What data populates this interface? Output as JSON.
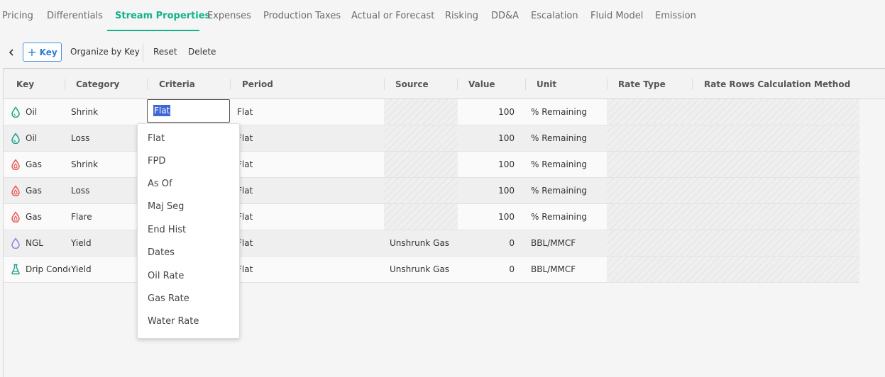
{
  "tabs": [
    {
      "label": "Pricing"
    },
    {
      "label": "Differentials"
    },
    {
      "label": "Stream Properties",
      "active": true
    },
    {
      "label": "Expenses"
    },
    {
      "label": "Production Taxes"
    },
    {
      "label": "Actual or Forecast"
    },
    {
      "label": "Risking"
    },
    {
      "label": "DD&A"
    },
    {
      "label": "Escalation"
    },
    {
      "label": "Fluid Model"
    },
    {
      "label": "Emission"
    }
  ],
  "toolbar": {
    "key_button": "Key",
    "organize": "Organize by Key",
    "reset": "Reset",
    "delete": "Delete"
  },
  "columns": [
    "Key",
    "Category",
    "Criteria",
    "Period",
    "Source",
    "Value",
    "Unit",
    "Rate Type",
    "Rate Rows Calculation Method"
  ],
  "rows": [
    {
      "key": "Oil",
      "icon": "oil-drop-icon",
      "category": "Shrink",
      "criteria": "Flat",
      "period": "Flat",
      "source": "",
      "value": "100",
      "unit": "% Remaining"
    },
    {
      "key": "Oil",
      "icon": "oil-drop-icon",
      "category": "Loss",
      "criteria": "",
      "period": "Flat",
      "source": "",
      "value": "100",
      "unit": "% Remaining"
    },
    {
      "key": "Gas",
      "icon": "gas-flame-icon",
      "category": "Shrink",
      "criteria": "",
      "period": "Flat",
      "source": "",
      "value": "100",
      "unit": "% Remaining"
    },
    {
      "key": "Gas",
      "icon": "gas-flame-icon",
      "category": "Loss",
      "criteria": "",
      "period": "Flat",
      "source": "",
      "value": "100",
      "unit": "% Remaining"
    },
    {
      "key": "Gas",
      "icon": "gas-flame-icon",
      "category": "Flare",
      "criteria": "",
      "period": "Flat",
      "source": "",
      "value": "100",
      "unit": "% Remaining"
    },
    {
      "key": "NGL",
      "icon": "ngl-drop-icon",
      "category": "Yield",
      "criteria": "",
      "period": "Flat",
      "source": "Unshrunk Gas",
      "value": "0",
      "unit": "BBL/MMCF"
    },
    {
      "key": "Drip Condensate",
      "icon": "drip-flask-icon",
      "category": "Yield",
      "criteria": "",
      "period": "Flat",
      "source": "Unshrunk Gas",
      "value": "0",
      "unit": "BBL/MMCF"
    }
  ],
  "criteria_editor": {
    "value": "Flat"
  },
  "dropdown_options": [
    "Flat",
    "FPD",
    "As Of",
    "Maj Seg",
    "End Hist",
    "Dates",
    "Oil Rate",
    "Gas Rate",
    "Water Rate"
  ],
  "colors": {
    "accent": "#12b388",
    "oil": "#19a58a",
    "gas": "#e85a5a",
    "ngl": "#9b7be6",
    "drip": "#1f9f8c"
  }
}
